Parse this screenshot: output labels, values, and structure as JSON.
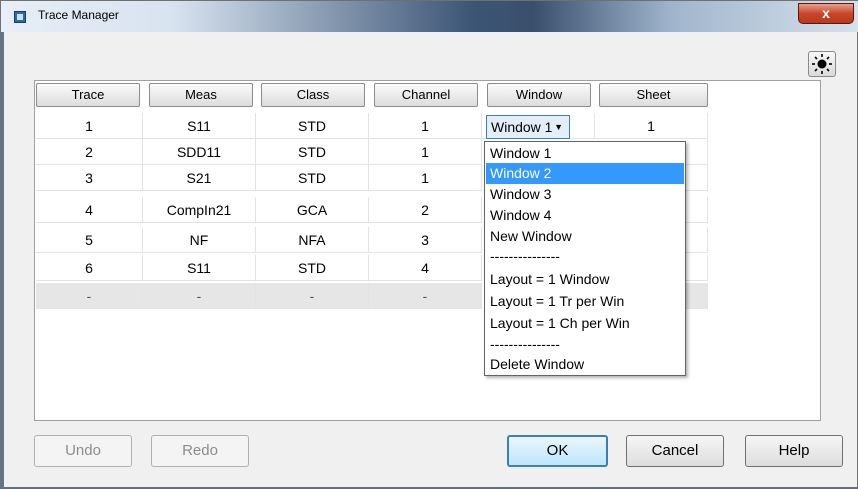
{
  "window": {
    "title": "Trace Manager",
    "close_glyph": "x"
  },
  "icons": {
    "app": "app-icon",
    "sun": "sun-icon"
  },
  "columns": [
    "Trace",
    "Meas",
    "Class",
    "Channel",
    "Window",
    "Sheet"
  ],
  "rows": [
    {
      "trace": "1",
      "meas": "S11",
      "class": "STD",
      "channel": "1",
      "window": "Window 1",
      "sheet": "1"
    },
    {
      "trace": "2",
      "meas": "SDD11",
      "class": "STD",
      "channel": "1",
      "window": "",
      "sheet": ""
    },
    {
      "trace": "3",
      "meas": "S21",
      "class": "STD",
      "channel": "1",
      "window": "",
      "sheet": ""
    },
    {
      "trace": "4",
      "meas": "CompIn21",
      "class": "GCA",
      "channel": "2",
      "window": "",
      "sheet": ""
    },
    {
      "trace": "5",
      "meas": "NF",
      "class": "NFA",
      "channel": "3",
      "window": "",
      "sheet": ""
    },
    {
      "trace": "6",
      "meas": "S11",
      "class": "STD",
      "channel": "4",
      "window": "",
      "sheet": ""
    },
    {
      "trace": "-",
      "meas": "-",
      "class": "-",
      "channel": "-",
      "window": "",
      "sheet": ""
    }
  ],
  "window_select": {
    "value": "Window 1",
    "arrow": "▼"
  },
  "dropdown": {
    "items": [
      {
        "label": "Window 1",
        "selected": false
      },
      {
        "label": "Window 2",
        "selected": true
      },
      {
        "label": "Window 3",
        "selected": false
      },
      {
        "label": "Window 4",
        "selected": false
      },
      {
        "label": "New Window",
        "selected": false
      },
      {
        "label": "---------------",
        "selected": false
      },
      {
        "label": "Layout = 1 Window",
        "selected": false
      },
      {
        "label": "Layout = 1 Tr per Win",
        "selected": false
      },
      {
        "label": "Layout = 1 Ch per Win",
        "selected": false
      },
      {
        "label": "---------------",
        "selected": false
      },
      {
        "label": "Delete Window",
        "selected": false
      }
    ]
  },
  "buttons": {
    "undo": "Undo",
    "redo": "Redo",
    "ok": "OK",
    "cancel": "Cancel",
    "help": "Help"
  },
  "colors": {
    "selection": "#3399ff",
    "default_button_border": "#3c7fb1",
    "close_button": "#c9462a"
  }
}
